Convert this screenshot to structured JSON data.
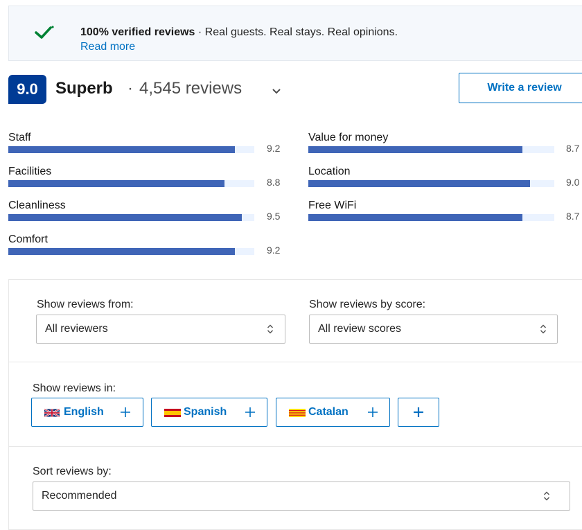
{
  "banner": {
    "bold": "100% verified reviews",
    "rest": " · Real guests. Real stays. Real opinions.",
    "link": "Read more"
  },
  "summary": {
    "score": "9.0",
    "word": "Superb",
    "separator": "·",
    "count": "4,545 reviews"
  },
  "write_review": "Write a review",
  "categories": [
    {
      "label": "Staff",
      "score": "9.2"
    },
    {
      "label": "Facilities",
      "score": "8.8"
    },
    {
      "label": "Cleanliness",
      "score": "9.5"
    },
    {
      "label": "Comfort",
      "score": "9.2"
    },
    {
      "label": "Value for money",
      "score": "8.7"
    },
    {
      "label": "Location",
      "score": "9.0"
    },
    {
      "label": "Free WiFi",
      "score": "8.7"
    }
  ],
  "filters": {
    "from_label": "Show reviews from:",
    "from_value": "All reviewers",
    "score_label": "Show reviews by score:",
    "score_value": "All review scores",
    "lang_label": "Show reviews in:",
    "languages": [
      "English",
      "Spanish",
      "Catalan"
    ],
    "sort_label": "Sort reviews by:",
    "sort_value": "Recommended"
  },
  "colors": {
    "brand": "#003b95",
    "link": "#0071c2",
    "bar": "#3f65b7",
    "check": "#008234"
  }
}
